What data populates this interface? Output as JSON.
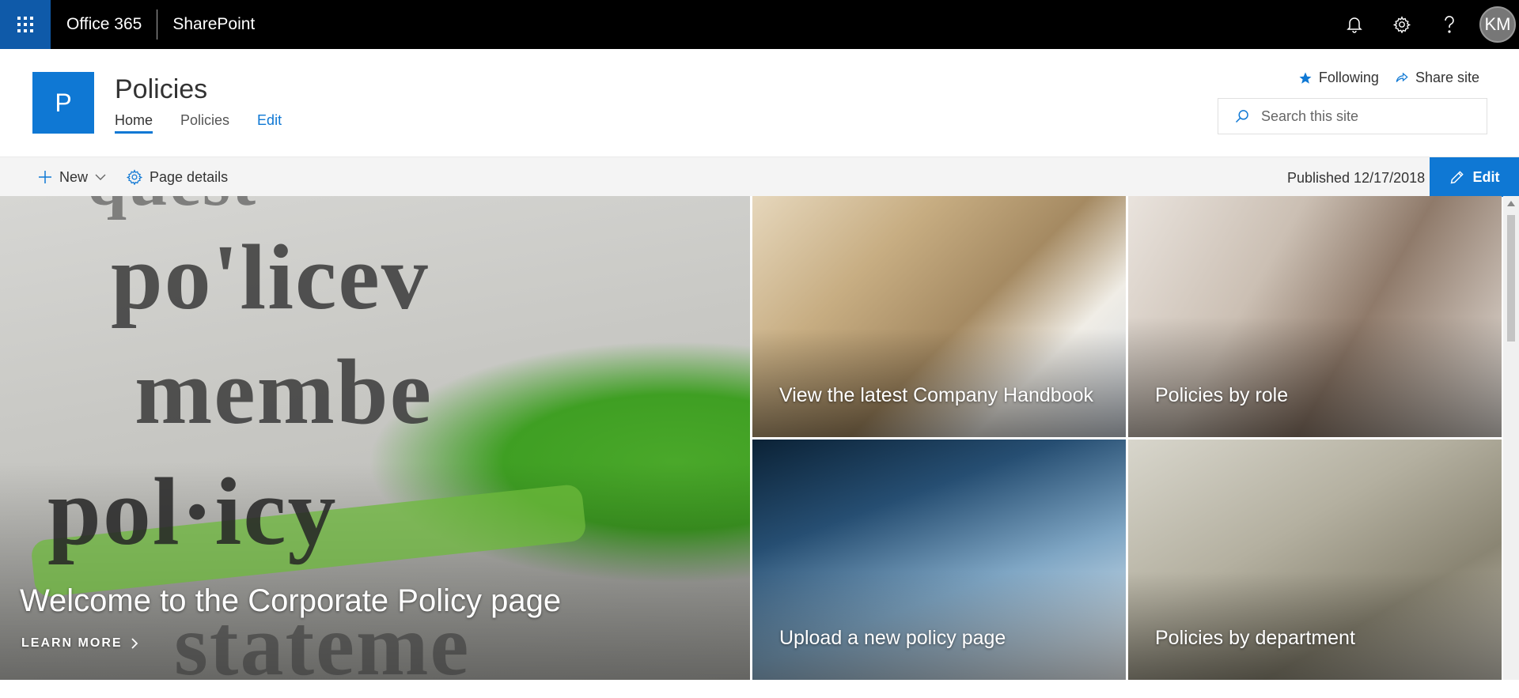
{
  "suitebar": {
    "brand": "Office 365",
    "app": "SharePoint",
    "avatar_initials": "KM",
    "icons": [
      "app-launcher-icon",
      "bell-icon",
      "gear-icon",
      "help-icon"
    ]
  },
  "site": {
    "logo_letter": "P",
    "title": "Policies",
    "nav": [
      {
        "label": "Home",
        "active": true
      },
      {
        "label": "Policies"
      }
    ],
    "nav_edit": "Edit",
    "following": "Following",
    "share": "Share site",
    "search_placeholder": "Search this site"
  },
  "commandbar": {
    "new": "New",
    "page_details": "Page details",
    "published": "Published 12/17/2018",
    "edit": "Edit"
  },
  "hero": {
    "main": {
      "title": "Welcome to the Corporate Policy page",
      "link": "LEARN MORE",
      "image_words": [
        "quest",
        "po'licev",
        "membe",
        "pol·icy",
        "stateme"
      ]
    },
    "tiles": [
      {
        "title": "View the latest Company Handbook"
      },
      {
        "title": "Policies by role"
      },
      {
        "title": "Upload a new policy page"
      },
      {
        "title": "Policies by department"
      }
    ]
  },
  "colors": {
    "accent": "#0f78d4",
    "suitebar": "#000000",
    "waffle": "#0f5aa9"
  }
}
